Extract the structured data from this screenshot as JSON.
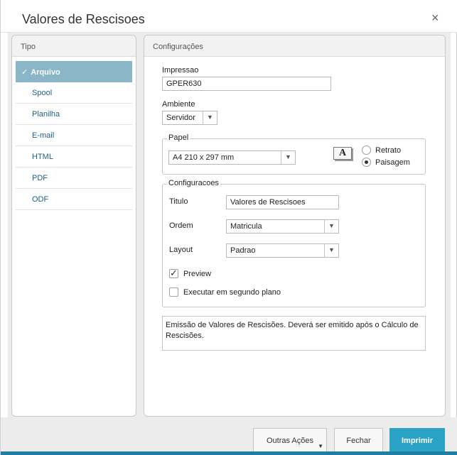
{
  "dialog": {
    "title": "Valores de Rescisoes",
    "close_glyph": "×"
  },
  "tipo": {
    "header": "Tipo",
    "items": [
      {
        "label": "Arquivo",
        "selected": true
      },
      {
        "label": "Spool"
      },
      {
        "label": "Planilha"
      },
      {
        "label": "E-mail"
      },
      {
        "label": "HTML"
      },
      {
        "label": "PDF"
      },
      {
        "label": "ODF"
      }
    ]
  },
  "config": {
    "header": "Configurações",
    "impressao_label": "Impressao",
    "impressao_value": "GPER630",
    "ambiente_label": "Ambiente",
    "ambiente_value": "Servidor",
    "papel": {
      "legend": "Papel",
      "size_value": "A4 210 x 297 mm",
      "orientation_icon": "A",
      "retrato_label": "Retrato",
      "paisagem_label": "Paisagem",
      "selected": "Paisagem"
    },
    "configuracoes": {
      "legend": "Configuracoes",
      "titulo_label": "Titulo",
      "titulo_value": "Valores de Rescisoes",
      "ordem_label": "Ordem",
      "ordem_value": "Matricula",
      "layout_label": "Layout",
      "layout_value": "Padrao",
      "preview_label": "Preview",
      "preview_checked": true,
      "segundo_plano_label": "Executar em segundo plano",
      "segundo_plano_checked": false
    },
    "description": "Emissão de Valores de Rescisões. Deverá ser emitido após o Cálculo de Rescisões."
  },
  "footer": {
    "outras_acoes": "Outras Ações",
    "fechar": "Fechar",
    "imprimir": "Imprimir"
  },
  "colors": {
    "accent": "#2aa3c6",
    "selected_item": "#8ab6c7",
    "link": "#1e5f8a"
  }
}
